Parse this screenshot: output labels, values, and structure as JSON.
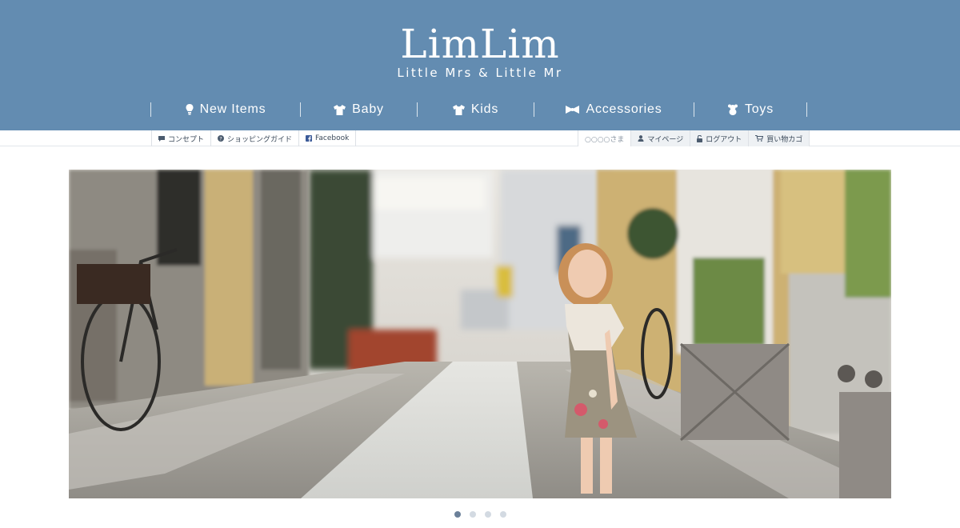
{
  "brand": {
    "logo_text": "LimLim",
    "tagline": "Little Mrs & Little Mr"
  },
  "main_nav": [
    {
      "label": "New Items",
      "icon": "lightbulb-icon"
    },
    {
      "label": "Baby",
      "icon": "tshirt-icon"
    },
    {
      "label": "Kids",
      "icon": "tshirt-icon"
    },
    {
      "label": "Accessories",
      "icon": "ribbon-icon"
    },
    {
      "label": "Toys",
      "icon": "teddy-bear-icon"
    }
  ],
  "utility_left": [
    {
      "label": "コンセプト",
      "icon": "chat-icon"
    },
    {
      "label": "ショッピングガイド",
      "icon": "question-circle-icon"
    },
    {
      "label": "Facebook",
      "icon": "facebook-icon"
    }
  ],
  "utility_right": [
    {
      "label": "○○○○さま"
    },
    {
      "label": "マイページ",
      "icon": "user-icon"
    },
    {
      "label": "ログアウト",
      "icon": "unlock-icon"
    },
    {
      "label": "買い物カゴ",
      "icon": "cart-icon"
    }
  ],
  "hero": {
    "image": "photo of a little girl standing on a cobblestone street",
    "slide_count": 4,
    "active_slide": 1
  },
  "colors": {
    "header_bg": "#638cb1",
    "text_light": "#ffffff",
    "dot_active": "#6b8099",
    "dot_inactive": "#d3dae2"
  }
}
